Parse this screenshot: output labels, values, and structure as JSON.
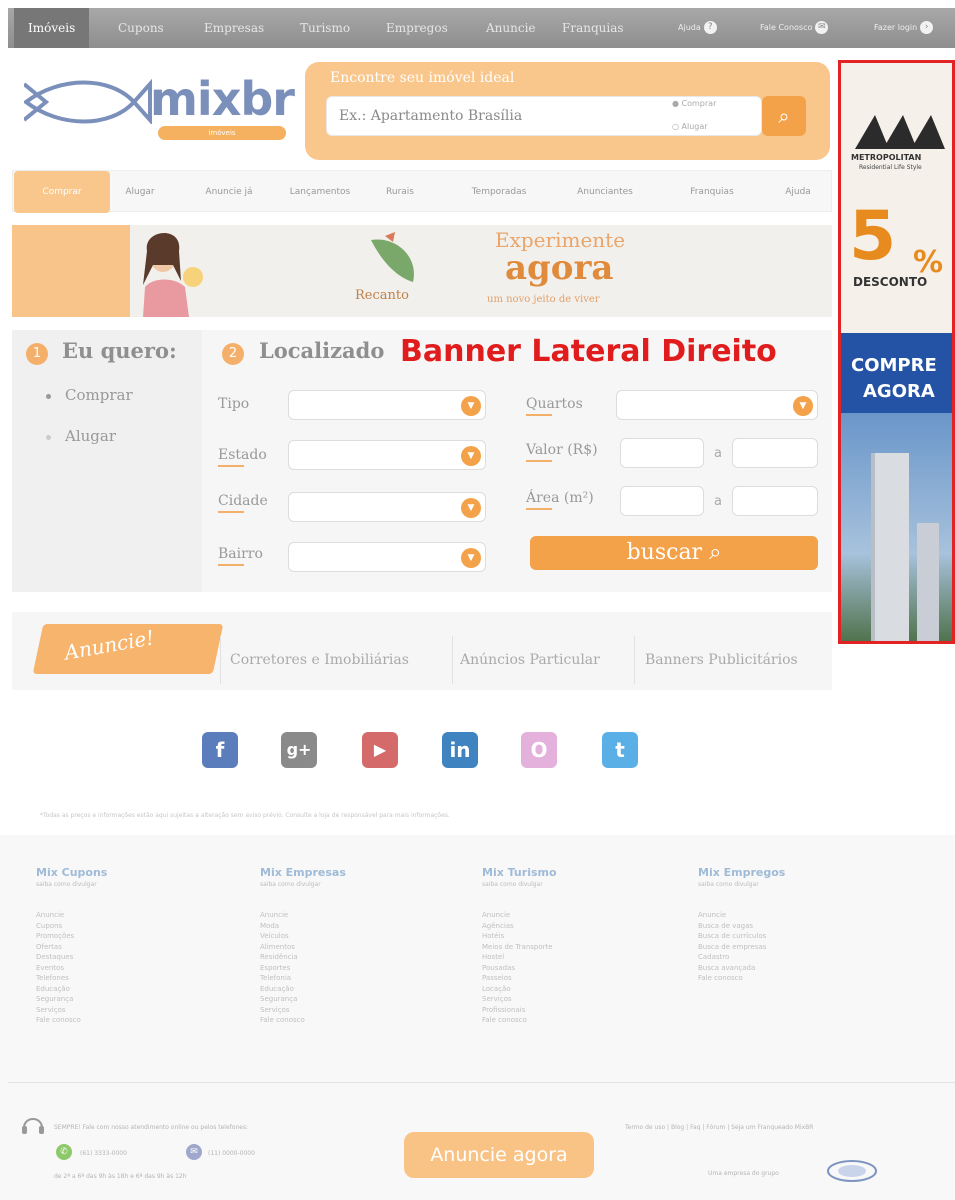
{
  "topbar": {
    "tabs": [
      "Imóveis",
      "Cupons",
      "Empresas",
      "Turismo",
      "Empregos",
      "Anuncie",
      "Franquias"
    ],
    "active_tab": "Imóveis",
    "right": {
      "ajuda": "Ajuda",
      "contato": "Fale Conosco",
      "login": "Fazer login"
    }
  },
  "logo": {
    "text": "mixbr",
    "badge": "imóveis"
  },
  "search": {
    "title": "Encontre seu imóvel ideal",
    "placeholder": "Ex.: Apartamento Brasília",
    "option_buy": "Comprar",
    "option_rent": "Alugar",
    "button_icon": "search-icon"
  },
  "mainnav": {
    "items": [
      "Comprar",
      "Alugar",
      "Anuncie já",
      "Lançamentos",
      "Rurais",
      "Temporadas",
      "Anunciantes",
      "Franquias",
      "Ajuda"
    ]
  },
  "banner": {
    "heading": "Experimente",
    "agora": "agora",
    "sub": "um novo jeito de viver",
    "brand": "Recanto"
  },
  "form": {
    "step1_num": "1",
    "step1_title": "Eu quero:",
    "radio_buy": "Comprar",
    "radio_rent": "Alugar",
    "step2_num": "2",
    "step2_title": "Localizado",
    "labels": {
      "tipo": "Tipo",
      "estado": "Estado",
      "cidade": "Cidade",
      "bairro": "Bairro",
      "quartos": "Quartos",
      "valor": "Valor (R$)",
      "area": "Área (m²)"
    },
    "range_sep": "a",
    "submit": "buscar",
    "dropdown_icon": "chevron-down-icon"
  },
  "overlay_label": "Banner Lateral Direito",
  "side_banner": {
    "brand": "METROPOLITAN",
    "brand_sub": "Residential Life Style",
    "discount_number": "5",
    "discount_pct": "%",
    "discount_word": "DESCONTO",
    "cta_1": "COMPRE",
    "cta_2": "AGORA"
  },
  "anuncie": {
    "tag": "Anuncie!",
    "links": [
      "Corretores e Imobiliárias",
      "Anúncios Particular",
      "Banners Publicitários"
    ]
  },
  "social": [
    {
      "icon": "facebook-icon",
      "glyph": "f",
      "color": "#5b7dbb"
    },
    {
      "icon": "google-plus-icon",
      "glyph": "g+",
      "color": "#8a8a8a"
    },
    {
      "icon": "youtube-icon",
      "glyph": "▶",
      "color": "#d46a6a"
    },
    {
      "icon": "linkedin-icon",
      "glyph": "in",
      "color": "#3f84c0"
    },
    {
      "icon": "orkut-icon",
      "glyph": "O",
      "color": "#e4b0dc"
    },
    {
      "icon": "twitter-icon",
      "glyph": "t",
      "color": "#5ab0e6"
    }
  ],
  "disclaimer": "*Todas as preços e informações estão aqui sujeitas a alteração sem aviso prévio. Consulte a loja de responsável para mais informações.",
  "footer": {
    "columns": [
      {
        "title": "Mix Cupons",
        "sub": "saiba como divulgar",
        "items": [
          "Anuncie",
          "Cupons",
          "Promoções",
          "Ofertas",
          "Destaques",
          "Eventos",
          "Telefones",
          "Educação",
          "Segurança",
          "Serviços",
          "Fale conosco"
        ]
      },
      {
        "title": "Mix Empresas",
        "sub": "saiba como divulgar",
        "items": [
          "Anuncie",
          "Moda",
          "Veículos",
          "Alimentos",
          "Residência",
          "Esportes",
          "Telefonia",
          "Educação",
          "Segurança",
          "Serviços",
          "Fale conosco"
        ]
      },
      {
        "title": "Mix Turismo",
        "sub": "saiba como divulgar",
        "items": [
          "Anuncie",
          "Agências",
          "Hotéis",
          "Meios de Transporte",
          "Hostel",
          "Pousadas",
          "Passeios",
          "Locação",
          "Serviços",
          "Profissionais",
          "Fale conosco"
        ]
      },
      {
        "title": "Mix Empregos",
        "sub": "saiba como divulgar",
        "items": [
          "Anuncie",
          "Busca de vagas",
          "Busca de currículos",
          "Busca de empresas",
          "Cadastro",
          "Busca avançada",
          "Fale conosco"
        ]
      }
    ],
    "contact_text": "SEMPRE! Fale com nosso atendimento online ou pelos telefones:",
    "phone1": "(61) 3333-0000",
    "phone2": "(11) 0000-0000",
    "hours": "de 2ª a 6ª das 9h às 18h e 6ª das 9h às 12h",
    "cta": "Anuncie agora",
    "links": "Termo de uso  |  Blog  |  Faq  |  Fórum  |  Seja um Franqueado MixBR",
    "group_text": "Uma empresa do grupo"
  }
}
